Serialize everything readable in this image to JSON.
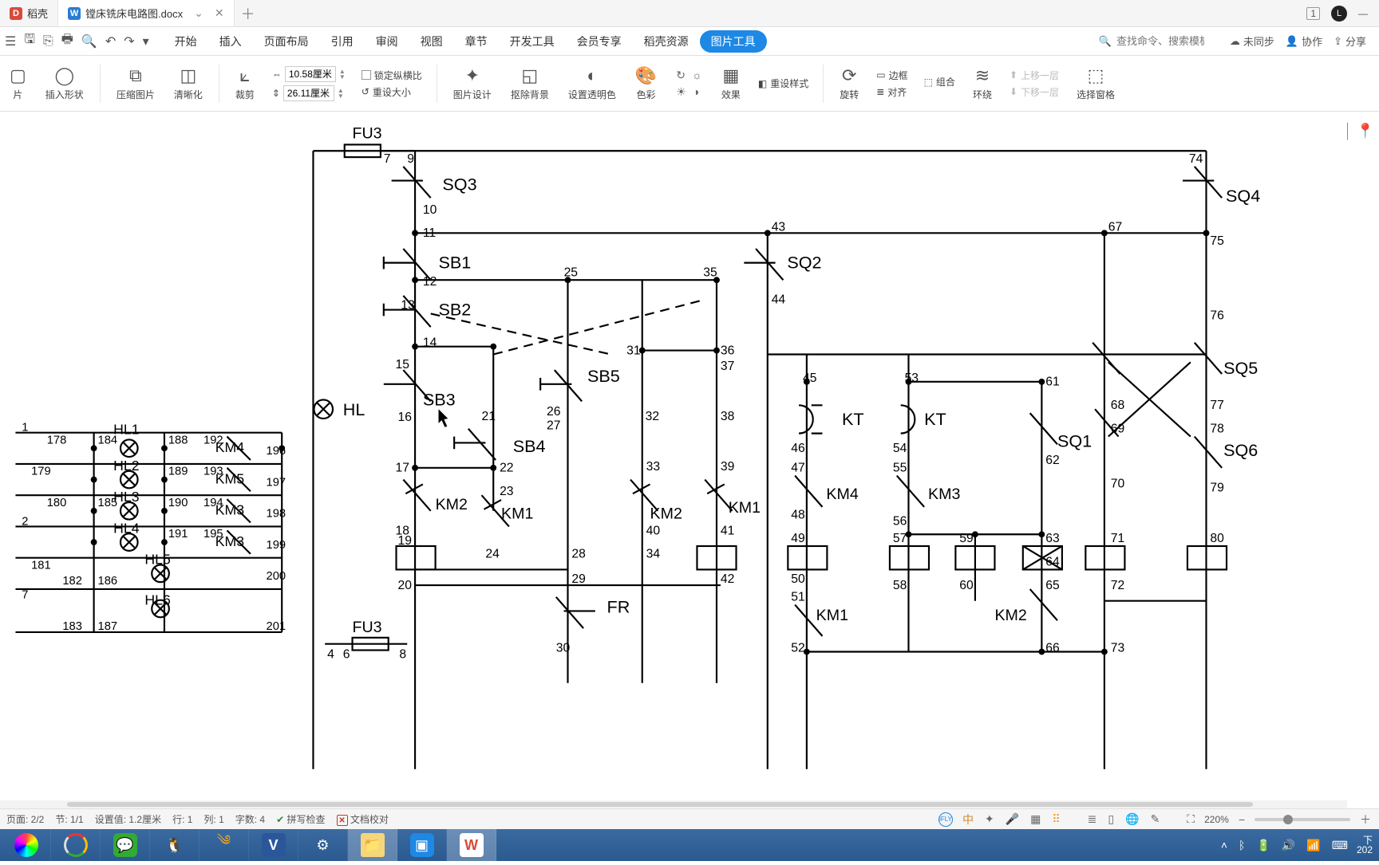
{
  "tabs": {
    "home": "稻壳",
    "doc": {
      "label": "镗床铣床电路图.docx"
    }
  },
  "titlebar_right": {
    "badge": "1",
    "avatar": "L"
  },
  "menus": [
    "开始",
    "插入",
    "页面布局",
    "引用",
    "审阅",
    "视图",
    "章节",
    "开发工具",
    "会员专享",
    "稻壳资源"
  ],
  "pill": "图片工具",
  "search_placeholder": "查找命令、搜索模板",
  "menubar_right": {
    "sync": "未同步",
    "coop": "协作",
    "share": "分享"
  },
  "ribbon": {
    "pian": "片",
    "insert_shape": "插入形状",
    "compress": "压缩图片",
    "clarity": "清晰化",
    "crop": "裁剪",
    "width_label": "10.58厘米",
    "height_label": "26.11厘米",
    "lock_ratio": "锁定纵横比",
    "reset_size": "重设大小",
    "pic_design": "图片设计",
    "remove_bg": "抠除背景",
    "set_transparent": "设置透明色",
    "color": "色彩",
    "effect": "效果",
    "reset_style": "重设样式",
    "rotate": "旋转",
    "border": "边框",
    "group": "组合",
    "align": "对齐",
    "wrap": "环绕",
    "move_up": "上移一层",
    "move_down": "下移一层",
    "select_pane": "选择窗格"
  },
  "status": {
    "page": "页面: 2/2",
    "section": "节: 1/1",
    "indent": "设置值: 1.2厘米",
    "row": "行: 1",
    "col": "列: 1",
    "words": "字数: 4",
    "spell": "拼写检查",
    "proof": "文档校对",
    "zoom": "220%"
  },
  "taskbar_time": {
    "line1": "下",
    "line2": "202"
  }
}
